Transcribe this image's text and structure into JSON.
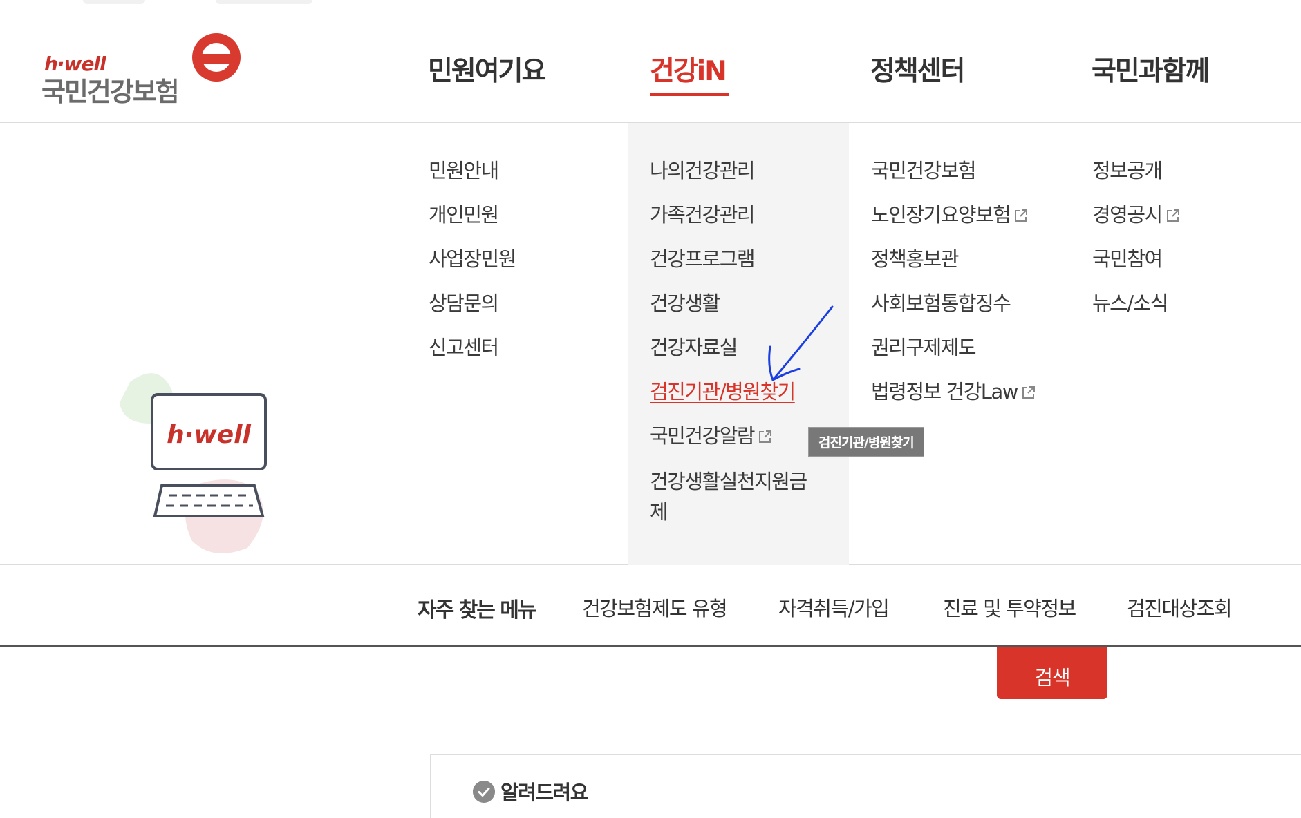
{
  "header": {
    "logo_small": "h·well",
    "logo_main": "국민건강보험",
    "nav": [
      {
        "label": "민원여기요"
      },
      {
        "label": "건강iN",
        "active": true
      },
      {
        "label": "정책센터"
      },
      {
        "label": "국민과함께"
      }
    ]
  },
  "menu": {
    "col1": [
      {
        "label": "민원안내"
      },
      {
        "label": "개인민원"
      },
      {
        "label": "사업장민원"
      },
      {
        "label": "상담문의"
      },
      {
        "label": "신고센터"
      }
    ],
    "col2": [
      {
        "label": "나의건강관리"
      },
      {
        "label": "가족건강관리"
      },
      {
        "label": "건강프로그램"
      },
      {
        "label": "건강생활"
      },
      {
        "label": "건강자료실"
      },
      {
        "label": "검진기관/병원찾기",
        "current": true
      },
      {
        "label": "국민건강알람",
        "external": true
      },
      {
        "label": "건강생활실천지원금"
      },
      {
        "label": "제"
      }
    ],
    "col3": [
      {
        "label": "국민건강보험"
      },
      {
        "label": "노인장기요양보험",
        "external": true
      },
      {
        "label": "정책홍보관"
      },
      {
        "label": "사회보험통합징수"
      },
      {
        "label": "권리구제제도"
      },
      {
        "label": "법령정보 건강Law",
        "external": true
      }
    ],
    "col4": [
      {
        "label": "정보공개"
      },
      {
        "label": "경영공시",
        "external": true
      },
      {
        "label": "국민참여"
      },
      {
        "label": "뉴스/소식"
      }
    ],
    "tooltip": "검진기관/병원찾기",
    "illustration_text": "h·well"
  },
  "quick_menu": {
    "title": "자주 찾는 메뉴",
    "links": [
      "건강보험제도 유형",
      "자격취득/가입",
      "진료 및 투약정보",
      "검진대상조회"
    ]
  },
  "search_button": "검색",
  "notice": {
    "title": "알려드려요"
  },
  "colors": {
    "accent": "#d8342a",
    "menu_bg": "#f4f4f4",
    "text": "#333333",
    "tooltip_bg": "#787878"
  }
}
